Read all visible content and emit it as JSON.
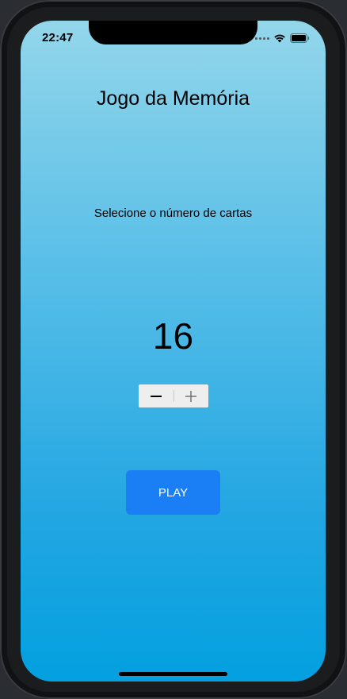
{
  "status_bar": {
    "time": "22:47"
  },
  "app": {
    "title": "Jogo da Memória",
    "subtitle": "Selecione o número de cartas",
    "card_count": "16"
  },
  "stepper": {
    "decrement_icon": "minus-icon",
    "increment_icon": "plus-icon"
  },
  "actions": {
    "play_label": "PLAY"
  },
  "colors": {
    "gradient_top": "#93d6ea",
    "gradient_bottom": "#03a0e0",
    "play_button": "#1a7ef5",
    "stepper_bg": "#eeeeef"
  }
}
